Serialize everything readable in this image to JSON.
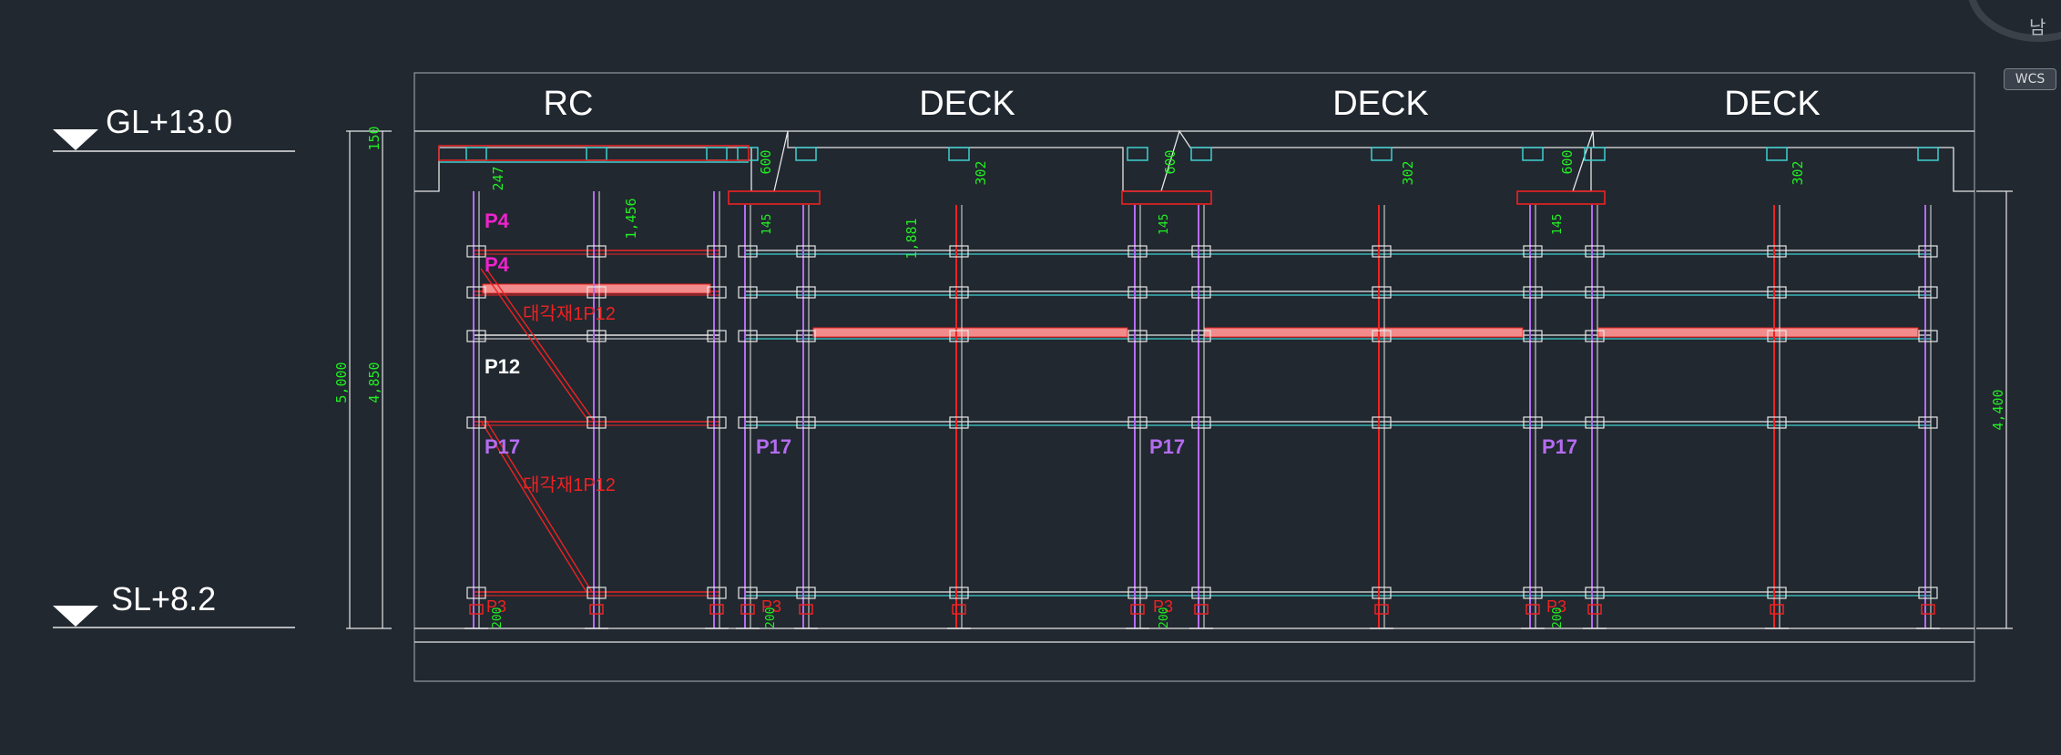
{
  "levels": {
    "top": "GL+13.0",
    "bottom": "SL+8.2"
  },
  "section_headers": [
    "RC",
    "DECK",
    "DECK",
    "DECK"
  ],
  "dimensions": {
    "overall_left": "5,000",
    "inner_left": "4,850",
    "right": "4,400",
    "top_slab": "150",
    "rc_beam_depth": "247",
    "rc_top_gap": "1,456",
    "deck_top_gap": "1,881",
    "deck_beam_depth": "600",
    "deck_head": "302",
    "short_jack": "145",
    "base_jack": "200"
  },
  "labels": {
    "p4": "P4",
    "p12": "P12",
    "p17": "P17",
    "brace": "대각재1P12",
    "base_mark": "P3"
  },
  "colors": {
    "background": "#212830",
    "frame": "#e6e6e6",
    "post": "#b46cf0",
    "ledger": "#3fd0d0",
    "brace": "#ee2222",
    "dimension": "#22ee22",
    "highlight": "#f28b8b",
    "magenta_label": "#ee22cc"
  },
  "ui": {
    "ucs_badge": "WCS",
    "viewcube_label": "남"
  }
}
